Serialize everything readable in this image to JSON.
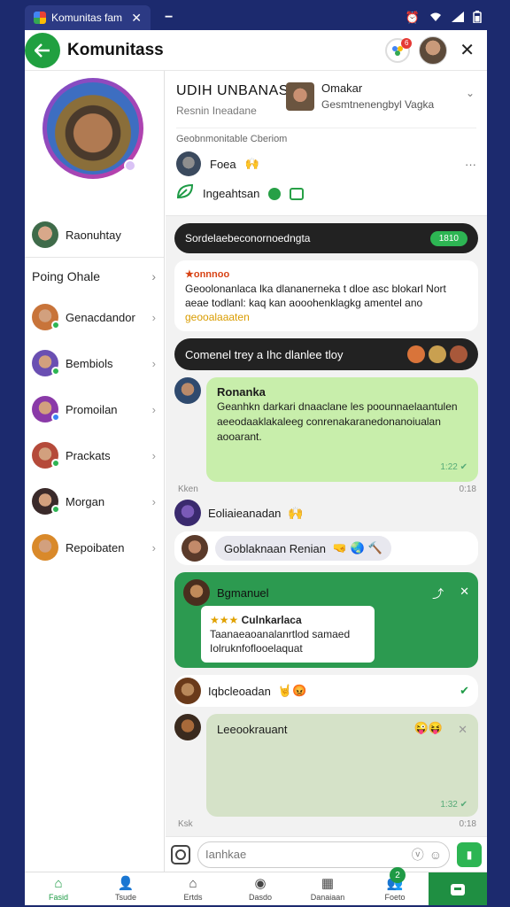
{
  "statusbar": {
    "tab_title": "Komunitas fam",
    "close_glyph": "✕",
    "minimize_glyph": "−",
    "icons": [
      "alarm-icon",
      "wifi-icon",
      "signal-icon",
      "battery-icon"
    ]
  },
  "header": {
    "title": "Komunitass",
    "notif_badge": "6"
  },
  "left": {
    "me_label": "Raonuhtay",
    "pinned_header": "Poing Ohale",
    "items": [
      {
        "label": "Genacdandor",
        "status": "#2db553",
        "av": "#c8743a"
      },
      {
        "label": "Bembiols",
        "status": "#2db553",
        "av": "#6a4fb2"
      },
      {
        "label": "Promoilan",
        "status": "#3b82f6",
        "av": "#8a3aa8"
      },
      {
        "label": "Prackats",
        "status": "#2db553",
        "av": "#b54a3a"
      },
      {
        "label": "Morgan",
        "status": "#2db553",
        "av": "#3a2a2a"
      },
      {
        "label": "Repoibaten",
        "status": "",
        "av": "#d9892a"
      }
    ]
  },
  "profile": {
    "name": "UDIH UNBANASD",
    "sub": "Resnin Ineadane",
    "right_title": "Omakar",
    "right_sub": "Gesmtnenengbyl Vagka",
    "section": "Geobnmonitable Cberiom",
    "row1_label": "Foea",
    "row1_emoji": "🙌",
    "row2_label": "Ingeahtsan"
  },
  "feed": {
    "banner_text": "Sordelaebeconornoedngta",
    "banner_tag": "1810",
    "card_header": "★onnnoo",
    "card_text": "Geoolonanlaca lka dlananerneka t dloe asc blokarl Nort aeae todlanl: kaq kan aooohenklagkg amentel ano",
    "card_highlight": "geooalaaaten",
    "group_pill": "Comenel trey a Ihc dlanlee tloy",
    "msg1_who": "Ronanka",
    "msg1_text": "Geanhkn darkari dnaaclane les poounnaelaantulen aeeodaaklakaleeg conrenakaranedonanoiualan aooarant.",
    "msg1_time": "1:22",
    "msg1_meta_left": "Kken",
    "msg1_meta_right": "0:18",
    "msg2_text": "Eoliaieanadan",
    "msg2_emoji": "🙌",
    "msg3_text": "Goblaknaan Renian",
    "msg3_emojis": "🤜 🌏 🔨",
    "green_head": "Bgmanuel",
    "inner_title": "Culnkarlaca",
    "inner_star": "★★★",
    "inner_text": "Taanaeaoanalanrtlod samaed Iolruknfoflooelaquat",
    "msg4_text": "Iqbcleoadan",
    "msg4_emojis": "🤘😡",
    "last_who": "Leeookrauant",
    "last_emojis": "😜😝",
    "last_time": "1:32",
    "last_meta_left": "Ksk",
    "last_meta_right": "0:18"
  },
  "composer": {
    "placeholder": "Ianhkae"
  },
  "nav": [
    {
      "label": "Fasid",
      "icon": "home-icon",
      "glyph": "⌂",
      "active": true
    },
    {
      "label": "Tsude",
      "icon": "person-icon",
      "glyph": "👤",
      "active": false
    },
    {
      "label": "Ertds",
      "icon": "home-outline-icon",
      "glyph": "⌂",
      "active": false
    },
    {
      "label": "Dasdo",
      "icon": "compass-icon",
      "glyph": "◉",
      "active": false
    },
    {
      "label": "Danaiaan",
      "icon": "grid-icon",
      "glyph": "▦",
      "active": false
    },
    {
      "label": "Foeto",
      "icon": "people-icon",
      "glyph": "👥",
      "active": false,
      "badge": "2"
    }
  ]
}
